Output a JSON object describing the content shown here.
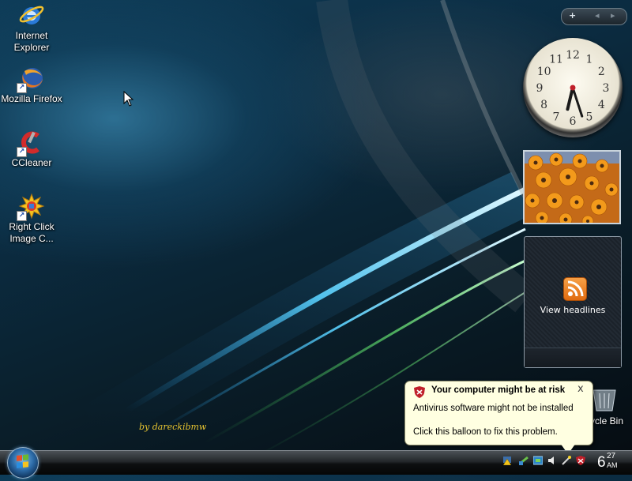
{
  "desktop": {
    "icons": [
      {
        "label": "Internet Explorer",
        "line1": "Internet",
        "line2": "Explorer",
        "icon": "internet-explorer-icon"
      },
      {
        "label": "Mozilla Firefox",
        "line1": "Mozilla Firefox",
        "line2": "",
        "icon": "firefox-icon"
      },
      {
        "label": "CCleaner",
        "line1": "CCleaner",
        "line2": "",
        "icon": "ccleaner-icon"
      },
      {
        "label": "Right Click Image C...",
        "line1": "Right Click",
        "line2": "Image C...",
        "icon": "right-click-image-converter-icon"
      }
    ],
    "recycle_bin_label": "ycle Bin",
    "signature": "by dareckibmw"
  },
  "sidebar": {
    "controls": {
      "add": "+",
      "prev": "◂",
      "next": "▸"
    },
    "clock": {
      "numerals": [
        "12",
        "1",
        "2",
        "3",
        "4",
        "5",
        "6",
        "7",
        "8",
        "9",
        "10",
        "11"
      ],
      "hour": 6,
      "minute": 27
    },
    "feed": {
      "label": "View headlines"
    }
  },
  "balloon": {
    "title": "Your computer might be at risk",
    "line1": "Antivirus software might not be installed",
    "line2": "Click this balloon to fix this problem.",
    "close": "x"
  },
  "taskbar": {
    "clock": {
      "hour": "6",
      "minute": "27",
      "ampm": "AM"
    },
    "tray_icons": [
      "warning-network-icon",
      "network-icon",
      "display-icon",
      "speaker-icon",
      "wand-icon",
      "security-shield-icon"
    ]
  },
  "colors": {
    "balloon_bg": "#ffffe1",
    "signature": "#e8c531",
    "security_red": "#c0202a"
  }
}
